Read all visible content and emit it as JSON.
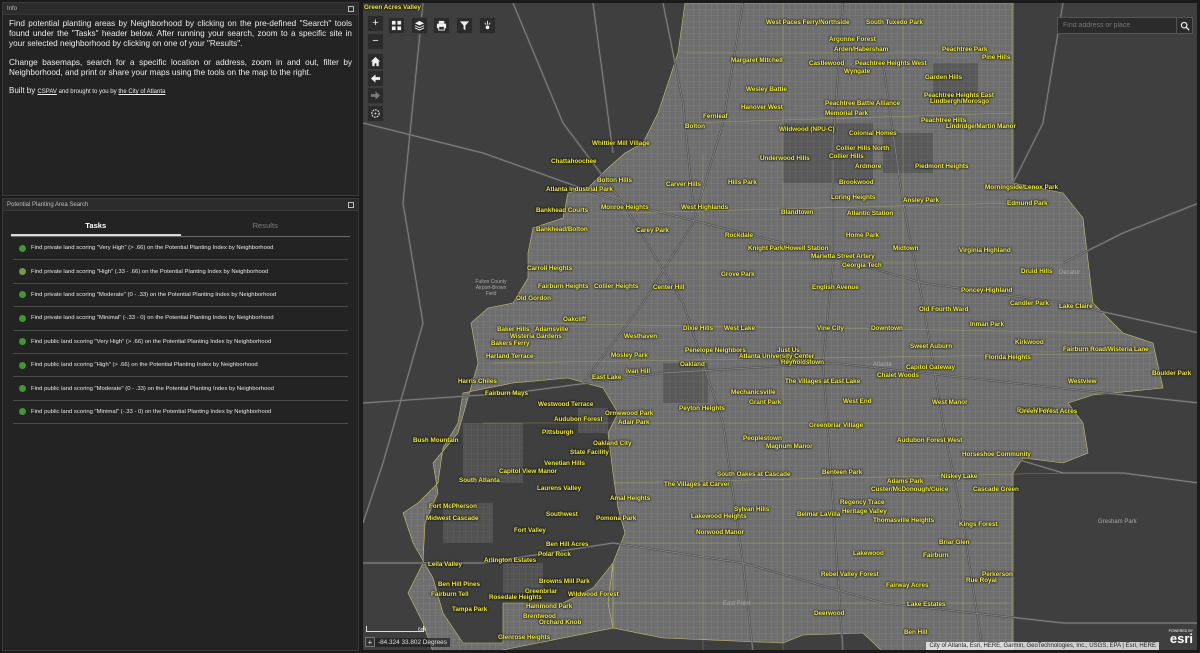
{
  "info": {
    "title": "Info",
    "paragraph1": "Find potential planting areas by Neighborhood by clicking on the pre-defined \"Search\" tools found under the \"Tasks\" header below. After running your search, zoom to a specific site in your selected neighborhood by clicking on one of your \"Results\".",
    "paragraph2": "Change basemaps, search for a specific location or address, zoom in and out, filter by Neighborhood, and print or share your maps using the tools on the map to the right.",
    "built_prefix": "Built by",
    "built_org": "CSPAV",
    "built_middle": "and brought to you by",
    "built_city": "the City of Atlanta"
  },
  "search_panel": {
    "title": "Potential Planting Area Search",
    "tabs": [
      {
        "label": "Tasks",
        "active": true
      },
      {
        "label": "Results",
        "active": false
      }
    ],
    "tasks": [
      {
        "label": "Find private land scoring \"Very High\" (> .66) on the Potential Planting Index by Neighborhood",
        "color": "#3f9a2e"
      },
      {
        "label": "Find private land scoring \"High\" (.33 - .66) on the Potential Planting Index by Neighborhood",
        "color": "#6f9a46"
      },
      {
        "label": "Find private land scoring \"Moderate\" (0 - .33) on the Potential Planting Index by Neighborhood",
        "color": "#3f9a2e"
      },
      {
        "label": "Find private land scoring \"Minimal\" (-.33 - 0) on the Potential Planting Index by Neighborhood",
        "color": "#3f9a2e"
      },
      {
        "label": "Find public land scoring \"Very High\" (> .66) on the Potential Planting Index by Neighborhood",
        "color": "#3f9a2e"
      },
      {
        "label": "Find public land scoring \"High\" (> .66) on the Potential Planting Index by Neighborhood",
        "color": "#3f9a2e"
      },
      {
        "label": "Find public land scoring \"Moderate\" (0 - .33) on the Potential Planting Index by Neighborhood",
        "color": "#3f9a2e"
      },
      {
        "label": "Find public land scoring \"Minimal\" (-.33 - 0) on the Potential Planting Index by Neighborhood",
        "color": "#3f9a2e"
      }
    ]
  },
  "map": {
    "search_placeholder": "Find address or place",
    "coordinates": "-84.324 33.802 Degrees",
    "scale_label": "6mi",
    "attribution": "City of Atlanta, Esri, HERE, Garmin, GeoTechnologies, Inc., USGS, EPA | Esri, HERE",
    "esri_powered": "POWERED BY",
    "esri_logo": "esri",
    "accent_color": "#f3ef3c",
    "toolbar_icons": [
      "zoom-in-icon",
      "zoom-out-icon",
      "home-icon",
      "back-icon",
      "forward-icon",
      "locate-icon",
      "grid-icon",
      "layers-icon",
      "print-icon",
      "filter-icon",
      "share-icon"
    ],
    "neighborhoods": [
      "West Paces Ferry/Northside",
      "South Tuxedo Park",
      "Argonne Forest",
      "Arden/Habersham",
      "Peachtree Park",
      "Pine Hills",
      "Margaret Mitchell",
      "Castlewood",
      "Peachtree Heights West",
      "Wyngate",
      "Garden Hills",
      "Wesley Battle",
      "Peachtree Heights East",
      "Hanover West",
      "Peachtree Battle Alliance",
      "Lindbergh/Morosgo",
      "Fernleaf",
      "Memorial Park",
      "Peachtree Hills",
      "Bolton",
      "Wildwood (NPU-C)",
      "Colonial Homes",
      "Lindridge/Martin Manor",
      "Whittier Mill Village",
      "Collier Hills North",
      "Collier Hills",
      "Chattahoochee",
      "Underwood Hills",
      "Ardmore",
      "Piedmont Heights",
      "Bolton Hills",
      "Carver Hills",
      "Hills Park",
      "Brookwood",
      "Morningside/Lenox Park",
      "Atlanta Industrial Park",
      "Loring Heights",
      "Ansley Park",
      "Monroe Heights",
      "Bankhead Courts",
      "West Highlands",
      "Blandtown",
      "Atlantic Station",
      "Edmund Park",
      "Bankhead/Bolton",
      "Carey Park",
      "Rockdale",
      "Home Park",
      "Knight Park/Howell Station",
      "Midtown",
      "Virginia Highland",
      "Marietta Street Artery",
      "Georgia Tech",
      "Carroll Heights",
      "Grove Park",
      "Druid Hills",
      "Fairburn Heights",
      "Collier Heights",
      "Center Hill",
      "English Avenue",
      "Poncey-Highland",
      "Old Gordon",
      "Candler Park",
      "Old Fourth Ward",
      "Lake Claire",
      "Inman Park",
      "Oakcliff",
      "Baker Hills",
      "Adamsville",
      "Dixie Hills",
      "West Lake",
      "Vine City",
      "Downtown",
      "Wisteria Gardens",
      "Westhaven",
      "Bakers Ferry",
      "Penelope Neighbors",
      "Just Us",
      "Edgewood",
      "Kirkwood",
      "Sweet Auburn",
      "Fairburn Road/Wisteria Lane",
      "Harland Terrace",
      "Mosley Park",
      "Atlanta University Center",
      "Reynoldstown",
      "Florida Heights",
      "Oakland",
      "Capitol Gateway",
      "Chalet Woods",
      "Ivan Hill",
      "East Lake",
      "Boulder Park",
      "Harris Chiles",
      "The Villages at East Lake",
      "Westview",
      "Fairburn Mays",
      "Mechanicsville",
      "West End",
      "Grant Park",
      "West Manor",
      "Westwood Terrace",
      "Peyton Heights",
      "Ormewood Park",
      "East Atlanta",
      "Green Forest Acres",
      "Audubon Forest",
      "Adair Park",
      "Greenbriar Village",
      "Green Acres Valley",
      "Pittsburgh",
      "Midwest Cascade",
      "Bush Mountain",
      "Peoplestown",
      "Audubon Forest West",
      "Oakland City",
      "Magnum Manor",
      "State Facility",
      "Horseshoe Community",
      "Venetian Hills",
      "South Oakes at Cascade",
      "Capitol View Manor",
      "Benteen Park",
      "Niskey Lake",
      "South Atlanta",
      "Adams Park",
      "The Villages at Carver",
      "Custer/McDonough/Guice",
      "Cascade Green",
      "Laurens Valley",
      "Amal Heights",
      "Regency Trace",
      "Fort McPherson",
      "Sylvan Hills",
      "Belmar LaVilla",
      "Heritage Valley",
      "Southwest",
      "Pomona Park",
      "Lakewood Heights",
      "Thomasville Heights",
      "Kings Forest",
      "Fort Valley",
      "Norwood Manor",
      "Briar Glen",
      "Ben Hill Acres",
      "Polar Rock",
      "Lakewood",
      "Fairburn",
      "Arlington Estates",
      "Leila Valley",
      "Perkerson",
      "Rebel Valley Forest",
      "Rue Royal",
      "Browns Mill Park",
      "Fairway Acres",
      "Ben Hill Pines",
      "Greenbriar",
      "Wildwood Forest",
      "Fairburn Tell",
      "Rosedale Heights",
      "Lake Estates",
      "Tampa Park",
      "Hammond Park",
      "Deerwood",
      "Brentwood",
      "Orchard Knob",
      "Ben Hill",
      "Glenrose Heights"
    ],
    "places": [
      "Fulton County Airport-Brown Field",
      "Atlanta",
      "Decatur",
      "East Point",
      "Gresham Park"
    ]
  }
}
